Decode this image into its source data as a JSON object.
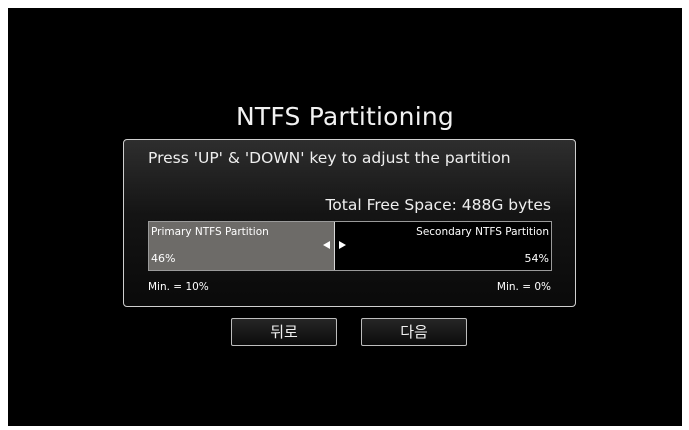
{
  "dialog": {
    "title": "NTFS Partitioning",
    "instruction": "Press 'UP' & 'DOWN' key to adjust the partition",
    "total_free_space": "Total Free Space: 488G bytes"
  },
  "partition": {
    "primary_label": "Primary NTFS Partition",
    "primary_percent_text": "46%",
    "primary_fraction": 0.46,
    "secondary_label": "Secondary NTFS Partition",
    "secondary_percent_text": "54%",
    "min_primary": "Min. = 10%",
    "min_secondary": "Min. = 0%",
    "left_arrow_icon": "triangle-left-icon",
    "right_arrow_icon": "triangle-right-icon"
  },
  "buttons": {
    "back_label": "뒤로",
    "next_label": "다음"
  },
  "colors": {
    "screen_background": "#000000",
    "primary_segment": "#6d6b68",
    "text": "#efefef"
  }
}
